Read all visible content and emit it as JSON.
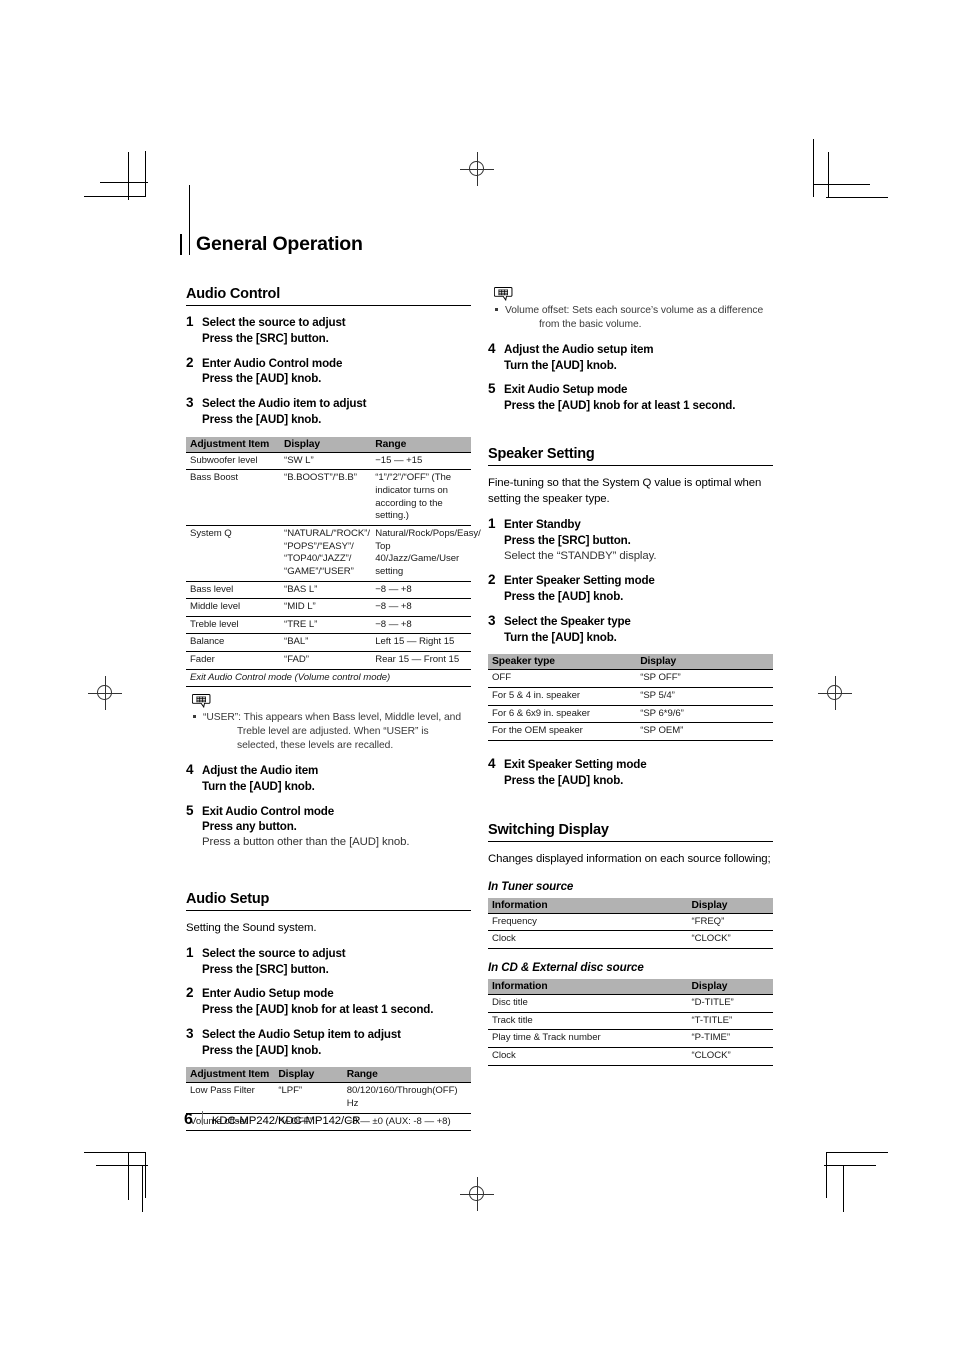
{
  "document": {
    "page_title": "General Operation",
    "page_number": "6",
    "model": "KDC-MP242/KDC-MP142/CR"
  },
  "left_column": {
    "audio_control": {
      "heading": "Audio Control",
      "steps": [
        {
          "num": "1",
          "headline": "Select the source to adjust",
          "sub": "Press the [SRC] button."
        },
        {
          "num": "2",
          "headline": "Enter Audio Control mode",
          "sub": "Press the [AUD] knob."
        },
        {
          "num": "3",
          "headline": "Select the Audio item to adjust",
          "sub": "Press the [AUD] knob."
        }
      ],
      "table": {
        "headers": [
          "Adjustment Item",
          "Display",
          "Range"
        ],
        "rows": [
          [
            "Subwoofer level",
            "“SW L”",
            "−15 — +15"
          ],
          [
            "Bass Boost",
            "“B.BOOST”/“B.B”",
            "“1”/“2”/“OFF” (The indicator turns on according to the setting.)"
          ],
          [
            "System Q",
            "“NATURAL/“ROCK”/ “POPS”/“EASY”/ “TOP40/“JAZZ”/ “GAME”/“USER”",
            "Natural/Rock/Pops/Easy/ Top 40/Jazz/Game/User setting"
          ],
          [
            "Bass level",
            "“BAS L”",
            "−8 — +8"
          ],
          [
            "Middle level",
            "“MID L”",
            "−8 — +8"
          ],
          [
            "Treble level",
            "“TRE L”",
            "−8 — +8"
          ],
          [
            "Balance",
            "“BAL”",
            "Left 15 — Right 15"
          ],
          [
            "Fader",
            "“FAD”",
            "Rear 15 — Front 15"
          ]
        ],
        "exit_row": "Exit Audio Control mode  (Volume control mode)"
      },
      "note": {
        "icon": "note-bubble-icon",
        "text": "“USER”: This appears when Bass level, Middle level, and",
        "text_indent": "Treble level are adjusted. When “USER” is selected, these levels are recalled."
      },
      "steps_after": [
        {
          "num": "4",
          "headline": "Adjust the Audio item",
          "sub": "Turn the [AUD] knob."
        },
        {
          "num": "5",
          "headline": "Exit Audio Control mode",
          "sub": "Press any button.",
          "plain": "Press a button other than the [AUD] knob."
        }
      ]
    },
    "audio_setup": {
      "heading": "Audio Setup",
      "lead": "Setting the Sound system.",
      "steps": [
        {
          "num": "1",
          "headline": "Select the source to adjust",
          "sub": "Press the [SRC] button."
        },
        {
          "num": "2",
          "headline": "Enter Audio Setup mode",
          "sub": "Press the [AUD] knob for at least 1 second."
        },
        {
          "num": "3",
          "headline": "Select the Audio Setup item to adjust",
          "sub": "Press the [AUD] knob."
        }
      ],
      "table": {
        "headers": [
          "Adjustment Item",
          "Display",
          "Range"
        ],
        "rows": [
          [
            "Low Pass Filter",
            "“LPF”",
            "80/120/160/Through(OFF) Hz"
          ],
          [
            "Volume offset",
            "“V-OFF”",
            "−8 — ±0 (AUX: -8 — +8)"
          ]
        ]
      }
    }
  },
  "right_column": {
    "audio_setup_note": {
      "icon": "note-bubble-icon",
      "text": "Volume offset: Sets each source’s volume as a difference",
      "text_indent": "from the basic volume."
    },
    "audio_setup_steps": [
      {
        "num": "4",
        "headline": "Adjust the Audio setup item",
        "sub": "Turn the [AUD] knob."
      },
      {
        "num": "5",
        "headline": "Exit Audio Setup mode",
        "sub": "Press the [AUD] knob for at least 1 second."
      }
    ],
    "speaker_setting": {
      "heading": "Speaker Setting",
      "lead": "Fine-tuning so that the System Q value is optimal when setting the speaker type.",
      "steps": [
        {
          "num": "1",
          "headline": "Enter Standby",
          "sub": "Press the [SRC] button.",
          "plain": "Select the “STANDBY” display."
        },
        {
          "num": "2",
          "headline": "Enter Speaker Setting mode",
          "sub": "Press the [AUD] knob."
        },
        {
          "num": "3",
          "headline": "Select the Speaker type",
          "sub": "Turn the [AUD] knob."
        }
      ],
      "table": {
        "headers": [
          "Speaker type",
          "Display"
        ],
        "rows": [
          [
            "OFF",
            "“SP OFF”"
          ],
          [
            "For 5 & 4 in. speaker",
            "“SP 5/4”"
          ],
          [
            "For 6 & 6x9 in. speaker",
            "“SP 6*9/6”"
          ],
          [
            "For the OEM speaker",
            "“SP OEM”"
          ]
        ]
      },
      "steps_after": [
        {
          "num": "4",
          "headline": "Exit Speaker Setting mode",
          "sub": "Press the [AUD] knob."
        }
      ]
    },
    "switching_display": {
      "heading": "Switching Display",
      "lead": "Changes displayed information on each source following;",
      "tuner": {
        "sub_heading": "In Tuner source",
        "headers": [
          "Information",
          "Display"
        ],
        "rows": [
          [
            "Frequency",
            "“FREQ”"
          ],
          [
            "Clock",
            "“CLOCK”"
          ]
        ]
      },
      "disc": {
        "sub_heading": "In CD & External disc source",
        "headers": [
          "Information",
          "Display"
        ],
        "rows": [
          [
            "Disc title",
            "“D-TITLE”"
          ],
          [
            "Track title",
            "“T-TITLE”"
          ],
          [
            "Play time & Track number",
            "“P-TIME”"
          ],
          [
            "Clock",
            "“CLOCK”"
          ]
        ]
      }
    }
  }
}
